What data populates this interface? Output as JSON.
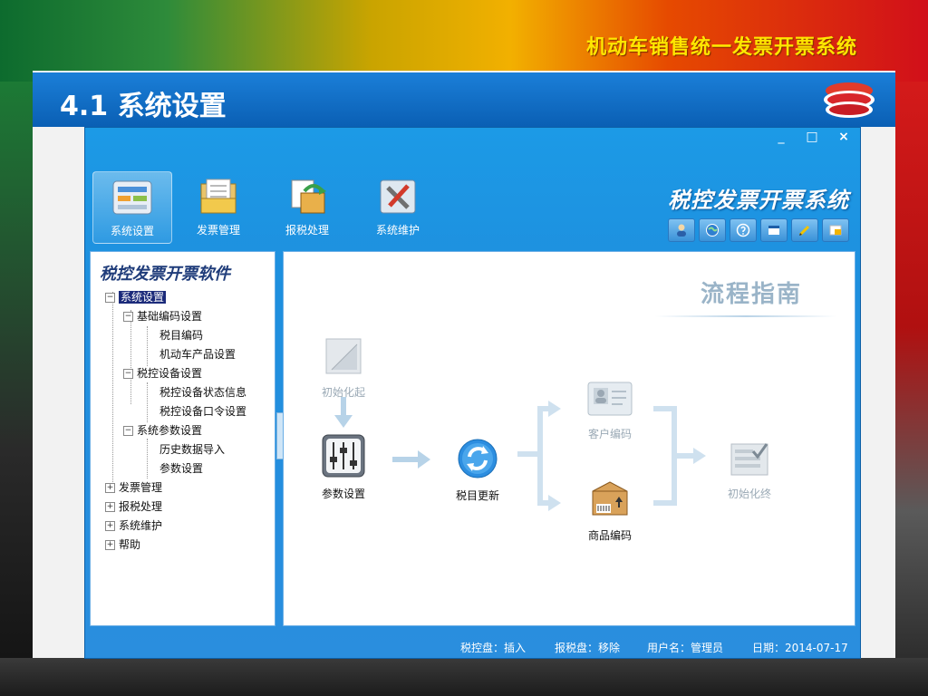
{
  "slide": {
    "heading": "机动车销售统一发票开票系统",
    "section_title": "4.1 系统设置"
  },
  "window": {
    "controls": {
      "minimize": "_",
      "maximize": "□",
      "close": "×"
    },
    "app_title": "税控发票开票系统",
    "toolbar": [
      {
        "label": "系统设置",
        "icon": "settings-panel-icon",
        "active": true
      },
      {
        "label": "发票管理",
        "icon": "folder-documents-icon",
        "active": false
      },
      {
        "label": "报税处理",
        "icon": "tax-report-icon",
        "active": false
      },
      {
        "label": "系统维护",
        "icon": "tools-icon",
        "active": false
      }
    ],
    "quick_icons": [
      "user-icon",
      "globe-icon",
      "help-icon",
      "window-icon",
      "pencil-icon",
      "lock-icon"
    ]
  },
  "tree": {
    "title": "税控发票开票软件",
    "nodes": {
      "root": "系统设置",
      "basic": "基础编码设置",
      "tax_code": "税目编码",
      "vehicle_product": "机动车产品设置",
      "device": "税控设备设置",
      "device_status": "税控设备状态信息",
      "device_password": "税控设备口令设置",
      "params": "系统参数设置",
      "history_import": "历史数据导入",
      "param_settings": "参数设置",
      "invoice_mgmt": "发票管理",
      "tax_report": "报税处理",
      "maintenance": "系统维护",
      "help": "帮助"
    },
    "toggles": {
      "expanded": "−",
      "collapsed": "+"
    }
  },
  "flow": {
    "title": "流程指南",
    "init_start": "初始化起",
    "param_settings": "参数设置",
    "tax_update": "税目更新",
    "customer_code": "客户编码",
    "product_code": "商品编码",
    "init_end": "初始化终"
  },
  "status": {
    "tax_disk": "税控盘：插入",
    "report_disk": "报税盘：移除",
    "username": "用户名：管理员",
    "date": "日期：2014-07-17"
  },
  "colors": {
    "window_blue": "#1e8fde",
    "heading_yellow": "#ffe600",
    "section_blue": "#0a5fb4"
  }
}
